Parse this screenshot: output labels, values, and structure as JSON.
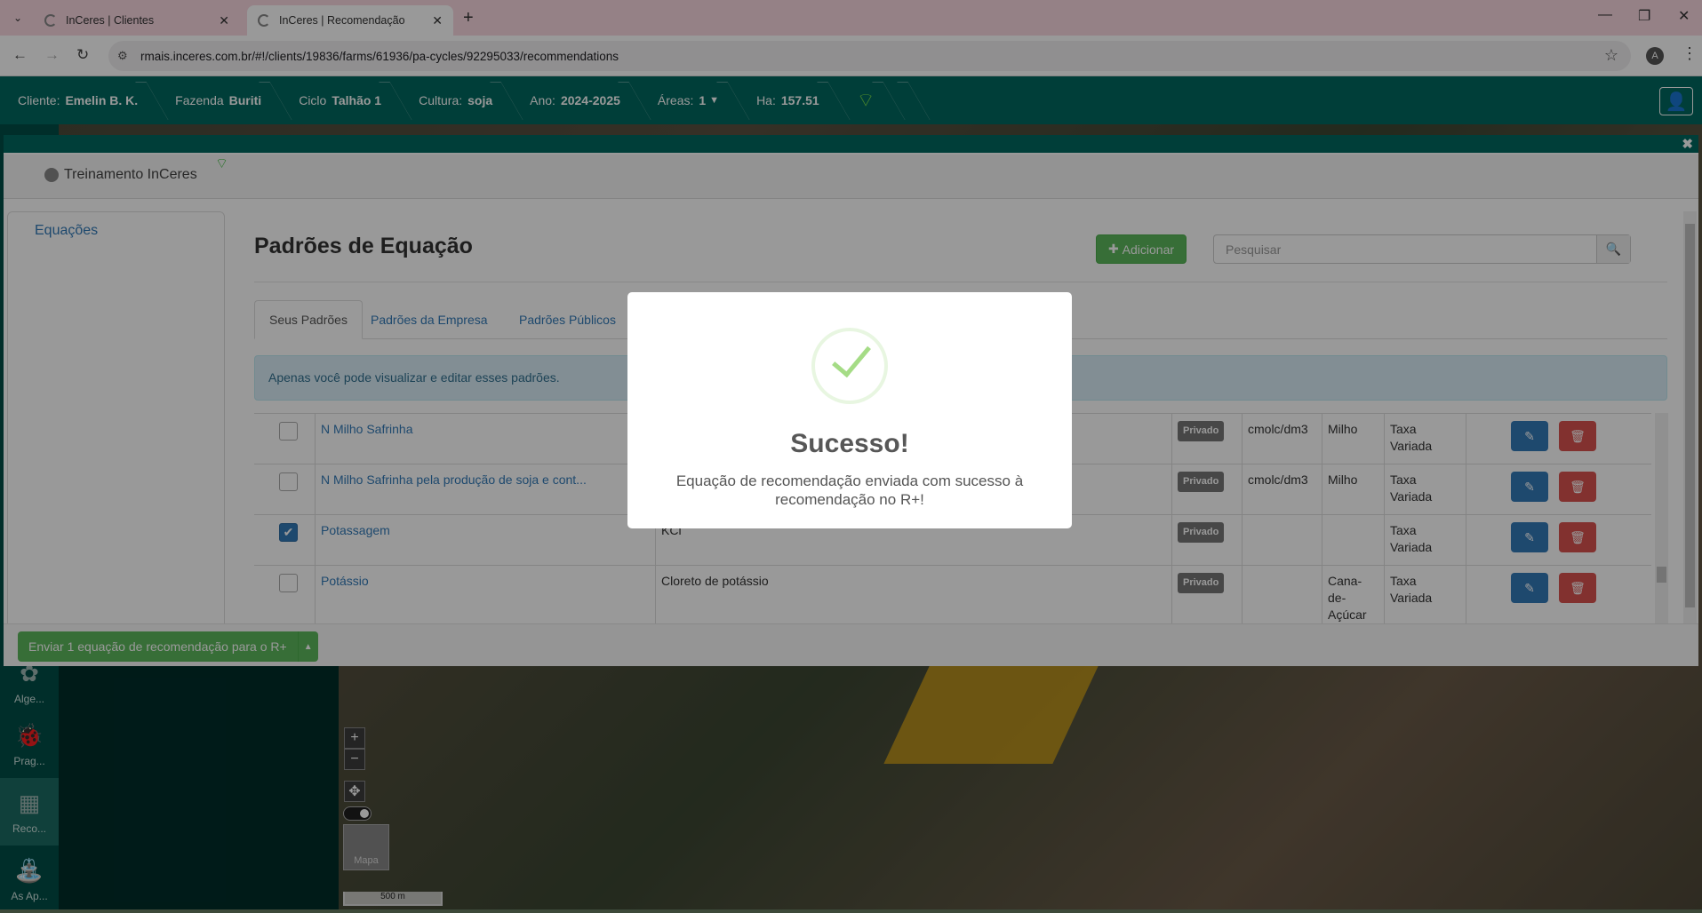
{
  "browser": {
    "tabs": [
      {
        "title": "InCeres | Clientes",
        "active": false
      },
      {
        "title": "InCeres | Recomendação",
        "active": true
      }
    ],
    "url": "rmais.inceres.com.br/#!/clients/19836/farms/61936/pa-cycles/92295033/recommendations",
    "profile_initial": "A"
  },
  "header": {
    "client_label": "Cliente:",
    "client_value": "Emelin B. K.",
    "farm_label": "Fazenda",
    "farm_value": "Buriti",
    "cycle_label": "Ciclo",
    "cycle_value": "Talhão 1",
    "crop_label": "Cultura:",
    "crop_value": "soja",
    "year_label": "Ano:",
    "year_value": "2024-2025",
    "areas_label": "Áreas:",
    "areas_value": "1",
    "ha_label": "Ha:",
    "ha_value": "157.51"
  },
  "rail": {
    "items": [
      {
        "label": "Alge...",
        "icon": "algae-icon"
      },
      {
        "label": "Prag...",
        "icon": "bug-icon"
      },
      {
        "label": "Reco...",
        "icon": "recommendation-icon"
      },
      {
        "label": "As Ap...",
        "icon": "sprayer-icon"
      }
    ]
  },
  "map": {
    "minimap_label": "Mapa",
    "scale_label": "500 m"
  },
  "modal": {
    "org_name": "Treinamento InCeres",
    "sidebar_item": "Equações",
    "title": "Padrões de Equação",
    "add_label": "Adicionar",
    "search_placeholder": "Pesquisar",
    "tabs": [
      "Seus Padrões",
      "Padrões da Empresa",
      "Padrões Públicos"
    ],
    "alert": "Apenas você pode visualizar e editar esses padrões.",
    "rows": [
      {
        "name": "N Milho Safrinha",
        "desc": "",
        "badge": "Privado",
        "unit": "cmolc/dm3",
        "crop": "Milho",
        "type": "Taxa Variada",
        "checked": false
      },
      {
        "name": "N Milho Safrinha pela produção de soja e cont...",
        "desc": "",
        "badge": "Privado",
        "unit": "cmolc/dm3",
        "crop": "Milho",
        "type": "Taxa Variada",
        "checked": false
      },
      {
        "name": "Potassagem",
        "desc": "KCl",
        "badge": "Privado",
        "unit": "",
        "crop": "",
        "type": "Taxa Variada",
        "checked": true
      },
      {
        "name": "Potássio",
        "desc": "Cloreto de potássio",
        "badge": "Privado",
        "unit": "",
        "crop": "Cana-de-Açúcar",
        "type": "Taxa Variada",
        "checked": false
      }
    ],
    "send_label": "Enviar 1 equação de recomendação para o R+"
  },
  "alert_dialog": {
    "title": "Sucesso!",
    "message": "Equação de recomendação enviada com sucesso à recomendação no R+!"
  },
  "colors": {
    "brand": "#00685f",
    "success": "#5cb85c",
    "danger": "#d9534f",
    "primary": "#337ab7"
  }
}
